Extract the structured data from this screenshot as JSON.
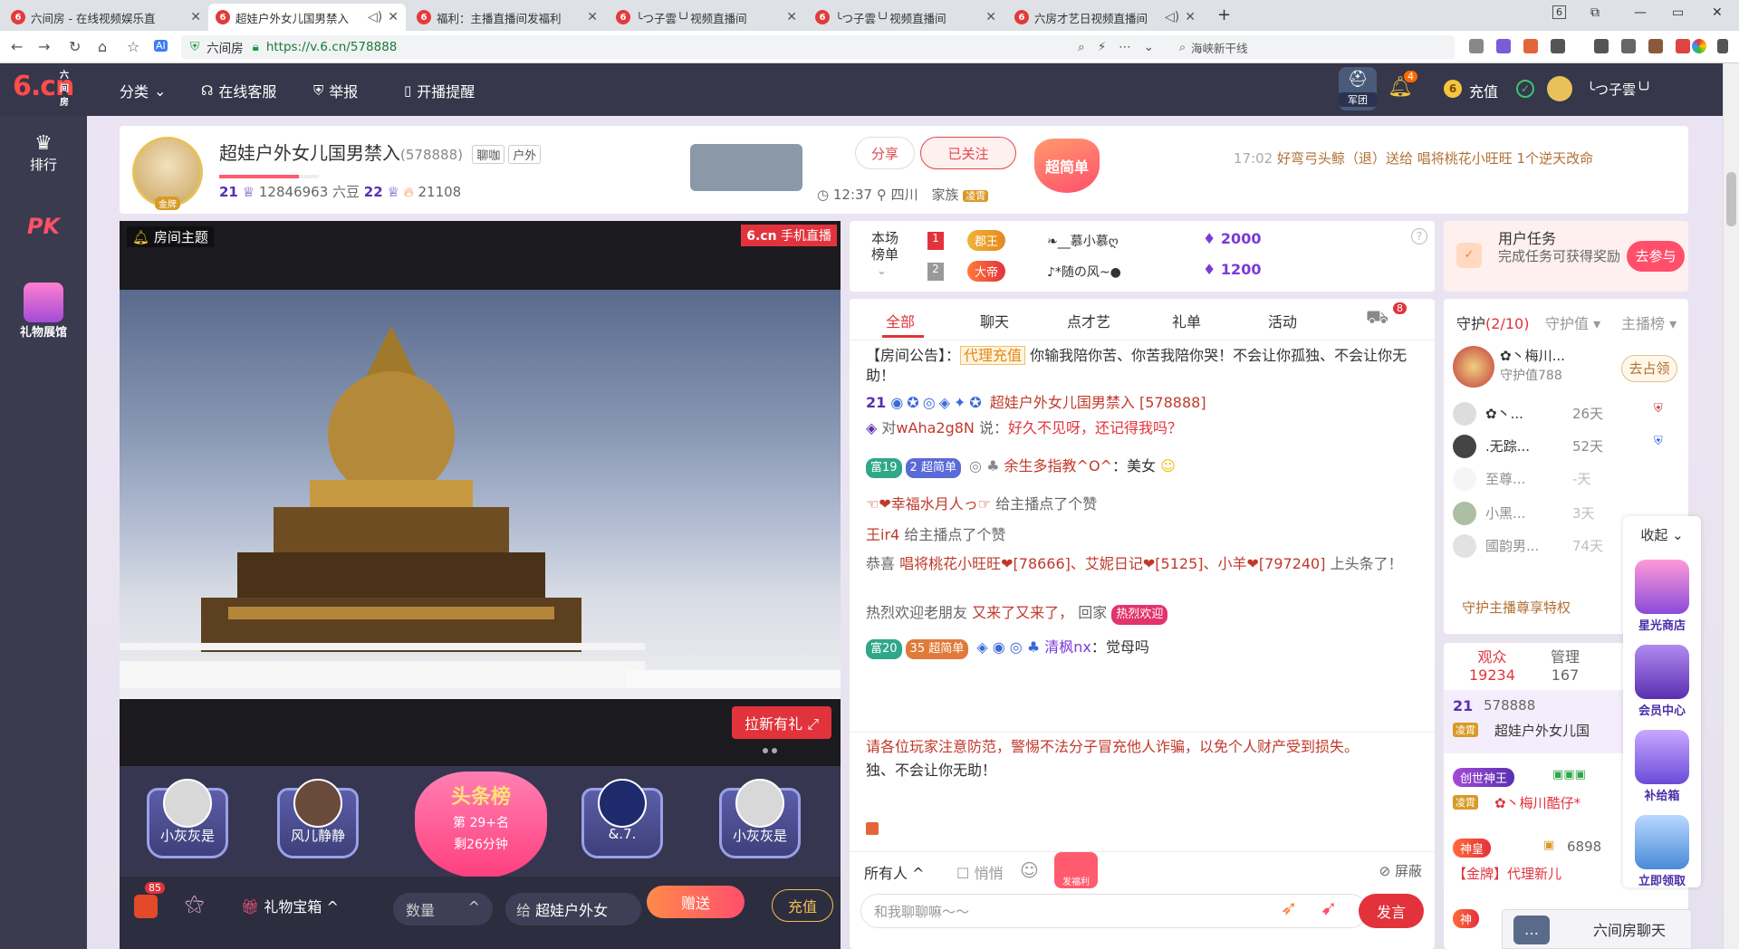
{
  "browser": {
    "tabs": [
      {
        "title": "六间房 - 在线视频娱乐直",
        "active": false
      },
      {
        "title": "超娃户外女儿国男禁入",
        "active": true
      },
      {
        "title": "福利：主播直播间发福利",
        "active": false
      },
      {
        "title": "╰つ子雲╰╯视频直播间",
        "active": false
      },
      {
        "title": "╰つ子雲╰╯视频直播间",
        "active": false
      },
      {
        "title": "六房才艺日视频直播间",
        "active": false
      }
    ],
    "new_tab": "+",
    "window_controls": [
      "6",
      "⧉",
      "—",
      "▭",
      "✕"
    ],
    "site_name": "六间房",
    "url": "https://v.6.cn/578888",
    "search_text": "海峡新干线"
  },
  "topnav": {
    "logo_main": "6.cn",
    "logo_sub": "六间房",
    "items": [
      "分类",
      "在线客服",
      "举报",
      "开播提醒"
    ],
    "army_label": "军团",
    "bell_count": "4",
    "recharge": "充值",
    "username": "╰つ子雲╰╯"
  },
  "leftbar": {
    "items": [
      "排行",
      "PK",
      "礼物展馆"
    ]
  },
  "room": {
    "title": "超娃户外女儿国男禁入",
    "room_id": "(578888)",
    "tags": [
      "聊咖",
      "户外"
    ],
    "avatar_badge": "金牌",
    "level_left": "21",
    "beans": "12846963 六豆",
    "level_right": "22",
    "fans": "21108",
    "time": "12:37",
    "location": "四川",
    "family": "家族",
    "family_tag": "凌霄",
    "share": "分享",
    "follow": "已关注",
    "super_badge": "超简单",
    "notice_time": "17:02",
    "notice_text": "好弯弓头鲸（退）送给 唱将桃花小旺旺 1个逆天改命"
  },
  "video": {
    "theme": "房间主题",
    "badge_logo": "6.cn",
    "badge_text": "手机直播",
    "promo": "拉新有礼",
    "seats": [
      "小灰灰是",
      "风儿静静",
      "&.7.",
      "小灰灰是"
    ],
    "toplist_title": "头条榜",
    "toplist_rank": "第 29+名",
    "toplist_time": "剩26分钟"
  },
  "bottom": {
    "bag_count": "85",
    "giftbox": "礼物宝箱",
    "quantity": "数量",
    "give_to_prefix": "给",
    "give_to": "超娃户外女",
    "send": "赠送",
    "recharge": "充值"
  },
  "rank": {
    "title": "本场榜单",
    "rows": [
      {
        "pos": "1",
        "title": "郡王",
        "name": "❧__慕小慕ღ",
        "score": "2000"
      },
      {
        "pos": "2",
        "title": "大帝",
        "name": "♪*随の风~●",
        "score": "1200"
      }
    ]
  },
  "chat": {
    "tabs": [
      "全部",
      "聊天",
      "点才艺",
      "礼单",
      "活动"
    ],
    "car_count": "8",
    "announce_label": "【房间公告】：",
    "announce_tag": "代理充值",
    "announce_text": "你输我陪你苦、你苦我陪你哭！不会让你孤独、不会让你无助！",
    "m1_level": "21",
    "m1_room": "超娃户外女儿国男禁入 [578888]",
    "m1_prefix": "对",
    "m1_user": "wAha2g8N",
    "m1_say": "说：",
    "m1_text": "好久不见呀，还记得我吗？",
    "m2_rich": "富19",
    "m2_title": "2 超简单",
    "m2_user": "余生多指教^O^",
    "m2_colon": "：",
    "m2_text": "美女",
    "m3_user": "☜❤幸福水月人っ☞",
    "m3_text": "给主播点了个赞",
    "m4_user": "王ir4",
    "m4_text": "给主播点了个赞",
    "m5_prefix": "恭喜",
    "m5_users": "唱将桃花小旺旺❤[78666]、艾妮日记❤[5125]、小羊❤[797240]",
    "m5_text": "上头条了！",
    "m6_prefix": "热烈欢迎老朋友",
    "m6_user": "又来了又来了，",
    "m6_text": "回家",
    "m6_tag": "热烈欢迎",
    "m7_rich": "富20",
    "m7_title": "35 超简单",
    "m7_user": "清枫nx",
    "m7_colon": "：",
    "m7_text": "觉母吗",
    "warning": "请各位玩家注意防范，警惕不法分子冒充他人诈骗，以免个人财产受到损失。",
    "warning_tail": "独、不会让你无助！",
    "target": "所有人",
    "whisper": "悄悄",
    "bag_label": "发福利",
    "block": "屏蔽",
    "placeholder": "和我聊聊嘛～～",
    "speak": "发言"
  },
  "task": {
    "title": "用户任务",
    "desc": "完成任务可获得奖励",
    "btn": "去参与"
  },
  "guard": {
    "tab_guard": "守护",
    "count": "(2/10)",
    "tab_value": "守护值",
    "tab_anchor": "主播榜",
    "top_name": "✿丶梅川...",
    "top_value": "守护值788",
    "claim": "去占领",
    "rows": [
      {
        "name": "✿丶...",
        "days": "26天"
      },
      {
        "name": ".无踪...",
        "days": "52天"
      },
      {
        "name": "至尊...",
        "days": "-天"
      },
      {
        "name": "小黑...",
        "days": "3天"
      },
      {
        "name": "國韵男...",
        "days": "74天"
      }
    ],
    "privilege": "守护主播尊享特权"
  },
  "audience": {
    "tab_aud": "观众",
    "aud_count": "19234",
    "tab_admin": "管理",
    "admin_count": "167",
    "r1_level": "21",
    "r1_id": "578888",
    "r1_tag": "凌霄",
    "r1_name": "超娃户外女儿国",
    "r2_title": "创世神王",
    "r2_tag": "凌霄",
    "r2_name": "✿丶梅川酷仔*",
    "r3_title": "神皇",
    "r3_id": "6898",
    "r3_name": "【金牌】代理新儿",
    "r4_title": "神"
  },
  "floatbar": {
    "collapse": "收起",
    "items": [
      "星光商店",
      "会员中心",
      "补给箱",
      "立即领取"
    ]
  },
  "chatdock": {
    "label": "六间房聊天"
  },
  "colors": {
    "accent": "#e2333c",
    "nav": "#36374a",
    "purple": "#5a2fb0"
  }
}
